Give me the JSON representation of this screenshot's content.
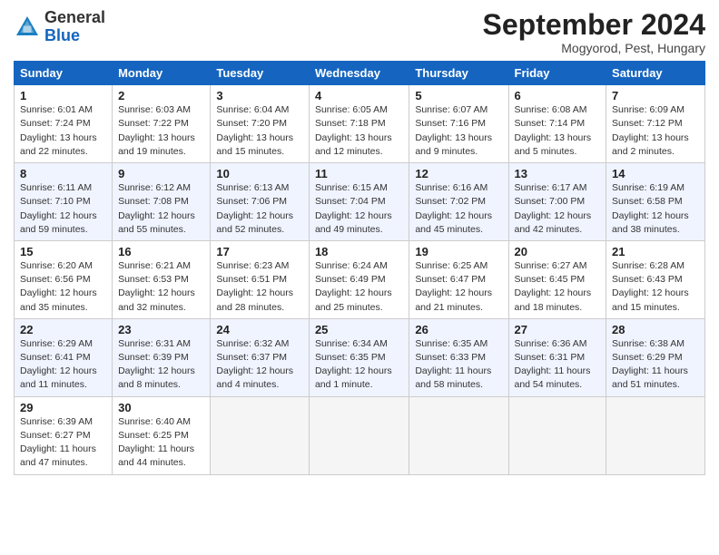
{
  "header": {
    "logo_general": "General",
    "logo_blue": "Blue",
    "month_title": "September 2024",
    "location": "Mogyorod, Pest, Hungary"
  },
  "columns": [
    "Sunday",
    "Monday",
    "Tuesday",
    "Wednesday",
    "Thursday",
    "Friday",
    "Saturday"
  ],
  "weeks": [
    [
      {
        "day": "1",
        "sunrise": "Sunrise: 6:01 AM",
        "sunset": "Sunset: 7:24 PM",
        "daylight": "Daylight: 13 hours and 22 minutes."
      },
      {
        "day": "2",
        "sunrise": "Sunrise: 6:03 AM",
        "sunset": "Sunset: 7:22 PM",
        "daylight": "Daylight: 13 hours and 19 minutes."
      },
      {
        "day": "3",
        "sunrise": "Sunrise: 6:04 AM",
        "sunset": "Sunset: 7:20 PM",
        "daylight": "Daylight: 13 hours and 15 minutes."
      },
      {
        "day": "4",
        "sunrise": "Sunrise: 6:05 AM",
        "sunset": "Sunset: 7:18 PM",
        "daylight": "Daylight: 13 hours and 12 minutes."
      },
      {
        "day": "5",
        "sunrise": "Sunrise: 6:07 AM",
        "sunset": "Sunset: 7:16 PM",
        "daylight": "Daylight: 13 hours and 9 minutes."
      },
      {
        "day": "6",
        "sunrise": "Sunrise: 6:08 AM",
        "sunset": "Sunset: 7:14 PM",
        "daylight": "Daylight: 13 hours and 5 minutes."
      },
      {
        "day": "7",
        "sunrise": "Sunrise: 6:09 AM",
        "sunset": "Sunset: 7:12 PM",
        "daylight": "Daylight: 13 hours and 2 minutes."
      }
    ],
    [
      {
        "day": "8",
        "sunrise": "Sunrise: 6:11 AM",
        "sunset": "Sunset: 7:10 PM",
        "daylight": "Daylight: 12 hours and 59 minutes."
      },
      {
        "day": "9",
        "sunrise": "Sunrise: 6:12 AM",
        "sunset": "Sunset: 7:08 PM",
        "daylight": "Daylight: 12 hours and 55 minutes."
      },
      {
        "day": "10",
        "sunrise": "Sunrise: 6:13 AM",
        "sunset": "Sunset: 7:06 PM",
        "daylight": "Daylight: 12 hours and 52 minutes."
      },
      {
        "day": "11",
        "sunrise": "Sunrise: 6:15 AM",
        "sunset": "Sunset: 7:04 PM",
        "daylight": "Daylight: 12 hours and 49 minutes."
      },
      {
        "day": "12",
        "sunrise": "Sunrise: 6:16 AM",
        "sunset": "Sunset: 7:02 PM",
        "daylight": "Daylight: 12 hours and 45 minutes."
      },
      {
        "day": "13",
        "sunrise": "Sunrise: 6:17 AM",
        "sunset": "Sunset: 7:00 PM",
        "daylight": "Daylight: 12 hours and 42 minutes."
      },
      {
        "day": "14",
        "sunrise": "Sunrise: 6:19 AM",
        "sunset": "Sunset: 6:58 PM",
        "daylight": "Daylight: 12 hours and 38 minutes."
      }
    ],
    [
      {
        "day": "15",
        "sunrise": "Sunrise: 6:20 AM",
        "sunset": "Sunset: 6:56 PM",
        "daylight": "Daylight: 12 hours and 35 minutes."
      },
      {
        "day": "16",
        "sunrise": "Sunrise: 6:21 AM",
        "sunset": "Sunset: 6:53 PM",
        "daylight": "Daylight: 12 hours and 32 minutes."
      },
      {
        "day": "17",
        "sunrise": "Sunrise: 6:23 AM",
        "sunset": "Sunset: 6:51 PM",
        "daylight": "Daylight: 12 hours and 28 minutes."
      },
      {
        "day": "18",
        "sunrise": "Sunrise: 6:24 AM",
        "sunset": "Sunset: 6:49 PM",
        "daylight": "Daylight: 12 hours and 25 minutes."
      },
      {
        "day": "19",
        "sunrise": "Sunrise: 6:25 AM",
        "sunset": "Sunset: 6:47 PM",
        "daylight": "Daylight: 12 hours and 21 minutes."
      },
      {
        "day": "20",
        "sunrise": "Sunrise: 6:27 AM",
        "sunset": "Sunset: 6:45 PM",
        "daylight": "Daylight: 12 hours and 18 minutes."
      },
      {
        "day": "21",
        "sunrise": "Sunrise: 6:28 AM",
        "sunset": "Sunset: 6:43 PM",
        "daylight": "Daylight: 12 hours and 15 minutes."
      }
    ],
    [
      {
        "day": "22",
        "sunrise": "Sunrise: 6:29 AM",
        "sunset": "Sunset: 6:41 PM",
        "daylight": "Daylight: 12 hours and 11 minutes."
      },
      {
        "day": "23",
        "sunrise": "Sunrise: 6:31 AM",
        "sunset": "Sunset: 6:39 PM",
        "daylight": "Daylight: 12 hours and 8 minutes."
      },
      {
        "day": "24",
        "sunrise": "Sunrise: 6:32 AM",
        "sunset": "Sunset: 6:37 PM",
        "daylight": "Daylight: 12 hours and 4 minutes."
      },
      {
        "day": "25",
        "sunrise": "Sunrise: 6:34 AM",
        "sunset": "Sunset: 6:35 PM",
        "daylight": "Daylight: 12 hours and 1 minute."
      },
      {
        "day": "26",
        "sunrise": "Sunrise: 6:35 AM",
        "sunset": "Sunset: 6:33 PM",
        "daylight": "Daylight: 11 hours and 58 minutes."
      },
      {
        "day": "27",
        "sunrise": "Sunrise: 6:36 AM",
        "sunset": "Sunset: 6:31 PM",
        "daylight": "Daylight: 11 hours and 54 minutes."
      },
      {
        "day": "28",
        "sunrise": "Sunrise: 6:38 AM",
        "sunset": "Sunset: 6:29 PM",
        "daylight": "Daylight: 11 hours and 51 minutes."
      }
    ],
    [
      {
        "day": "29",
        "sunrise": "Sunrise: 6:39 AM",
        "sunset": "Sunset: 6:27 PM",
        "daylight": "Daylight: 11 hours and 47 minutes."
      },
      {
        "day": "30",
        "sunrise": "Sunrise: 6:40 AM",
        "sunset": "Sunset: 6:25 PM",
        "daylight": "Daylight: 11 hours and 44 minutes."
      },
      null,
      null,
      null,
      null,
      null
    ]
  ]
}
